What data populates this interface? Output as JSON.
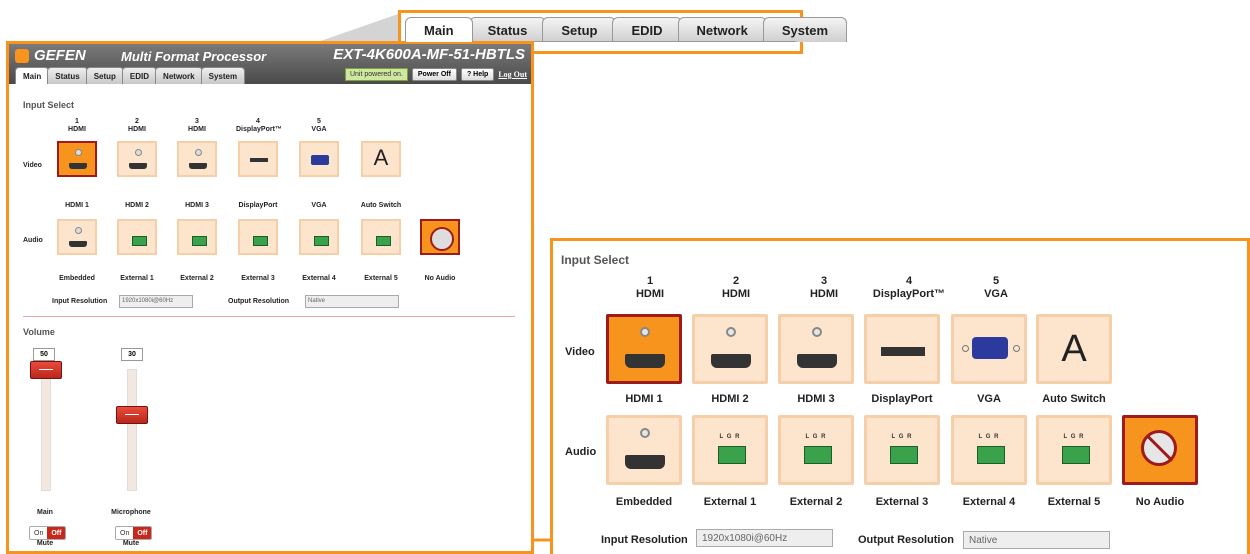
{
  "tabs": [
    "Main",
    "Status",
    "Setup",
    "EDID",
    "Network",
    "System"
  ],
  "app": {
    "brand": "GEFEN",
    "product": "Multi Format Processor",
    "model": "EXT-4K600A-MF-51-HBTLS",
    "status_text": "Unit powered on.",
    "power_off_label": "Power Off",
    "help_label": "? Help",
    "logout_label": "Log Out"
  },
  "input_select": {
    "title": "Input Select",
    "sources": [
      {
        "num": "1",
        "type": "HDMI"
      },
      {
        "num": "2",
        "type": "HDMI"
      },
      {
        "num": "3",
        "type": "HDMI"
      },
      {
        "num": "4",
        "type": "DisplayPort™"
      },
      {
        "num": "5",
        "type": "VGA"
      }
    ],
    "video_row_label": "Video",
    "audio_row_label": "Audio",
    "video_labels": [
      "HDMI 1",
      "HDMI 2",
      "HDMI 3",
      "DisplayPort",
      "VGA",
      "Auto Switch"
    ],
    "video_icons": [
      "hdmi-icon",
      "hdmi-icon",
      "hdmi-icon",
      "displayport-icon",
      "vga-icon",
      "auto-switch-icon"
    ],
    "video_selected": "HDMI 1",
    "auto_switch_glyph": "A",
    "audio_labels": [
      "Embedded",
      "External 1",
      "External 2",
      "External 3",
      "External 4",
      "External 5",
      "No Audio"
    ],
    "audio_icons": [
      "hdmi-icon",
      "terminal-block-icon",
      "terminal-block-icon",
      "terminal-block-icon",
      "terminal-block-icon",
      "terminal-block-icon",
      "no-audio-icon"
    ],
    "audio_selected": "No Audio",
    "terminal_label": "L G R",
    "input_resolution_label": "Input Resolution",
    "input_resolution_value": "1920x1080i@60Hz",
    "output_resolution_label": "Output Resolution",
    "output_resolution_value": "Native"
  },
  "volume": {
    "title": "Volume",
    "main": {
      "value": "50",
      "label": "Main",
      "mute_label": "Mute",
      "level": 0.5
    },
    "mic": {
      "value": "30",
      "label": "Microphone",
      "mute_label": "Mute",
      "level": 0.3
    },
    "on_label": "On",
    "off_label": "Off"
  },
  "colors": {
    "accent": "#f7941d",
    "selected_border": "#9e1b1b",
    "tile_bg": "#fde4cc",
    "header_bg": "#5a5a5a"
  }
}
